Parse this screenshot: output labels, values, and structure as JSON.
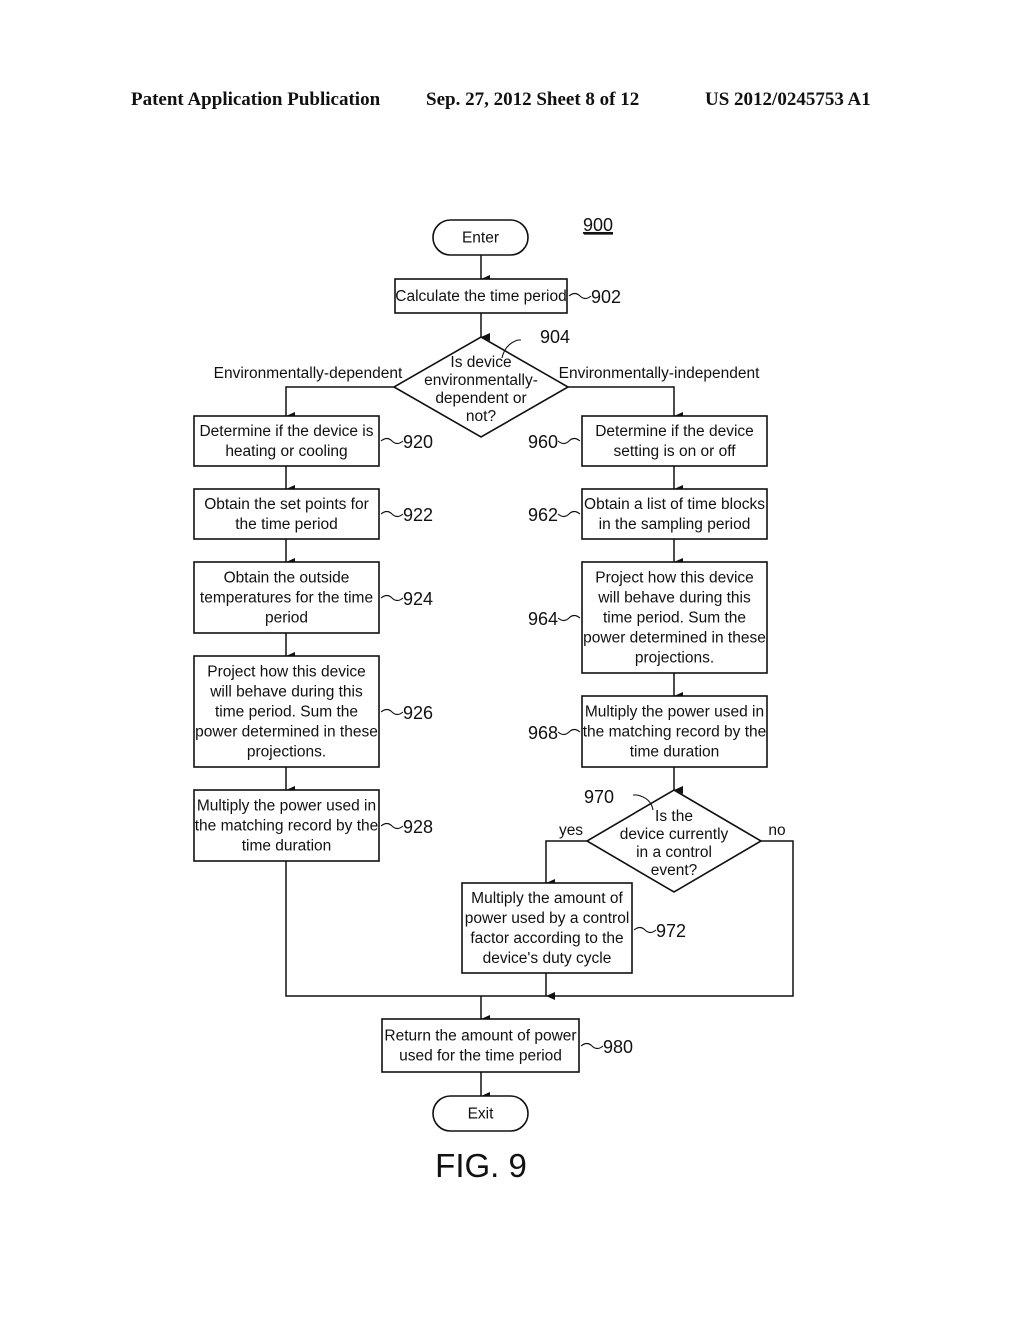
{
  "header": {
    "left": "Patent Application Publication",
    "center": "Sep. 27, 2012   Sheet 8 of 12",
    "right": "US 2012/0245753 A1"
  },
  "figure": {
    "ref": "900",
    "caption": "FIG. 9"
  },
  "nodes": {
    "enter": {
      "type": "terminal",
      "lines": [
        "Enter"
      ]
    },
    "n902": {
      "type": "process",
      "ref": "902",
      "lines": [
        "Calculate the time period"
      ]
    },
    "n904": {
      "type": "decision",
      "ref": "904",
      "lines": [
        "Is device",
        "environmentally-",
        "dependent or",
        "not?"
      ]
    },
    "n920": {
      "type": "process",
      "ref": "920",
      "lines": [
        "Determine if the device is",
        "heating or cooling"
      ]
    },
    "n922": {
      "type": "process",
      "ref": "922",
      "lines": [
        "Obtain the set points for",
        "the time period"
      ]
    },
    "n924": {
      "type": "process",
      "ref": "924",
      "lines": [
        "Obtain the outside",
        "temperatures for the time",
        "period"
      ]
    },
    "n926": {
      "type": "process",
      "ref": "926",
      "lines": [
        "Project how this device",
        "will behave during this",
        "time period. Sum the",
        "power determined in these",
        "projections."
      ]
    },
    "n928": {
      "type": "process",
      "ref": "928",
      "lines": [
        "Multiply the power used in",
        "the matching record by the",
        "time duration"
      ]
    },
    "n960": {
      "type": "process",
      "ref": "960",
      "lines": [
        "Determine if the device",
        "setting is on or off"
      ]
    },
    "n962": {
      "type": "process",
      "ref": "962",
      "lines": [
        "Obtain a list of time blocks",
        "in the sampling period"
      ]
    },
    "n964": {
      "type": "process",
      "ref": "964",
      "lines": [
        "Project how this device",
        "will behave during this",
        "time period. Sum the",
        "power determined in these",
        "projections."
      ]
    },
    "n968": {
      "type": "process",
      "ref": "968",
      "lines": [
        "Multiply the power used in",
        "the matching record by the",
        "time duration"
      ]
    },
    "n970": {
      "type": "decision",
      "ref": "970",
      "lines": [
        "Is the",
        "device currently",
        "in a control",
        "event?"
      ]
    },
    "n972": {
      "type": "process",
      "ref": "972",
      "lines": [
        "Multiply the amount of",
        "power used by a control",
        "factor according to the",
        "device's duty cycle"
      ]
    },
    "n980": {
      "type": "process",
      "ref": "980",
      "lines": [
        "Return the amount of power",
        "used for the time period"
      ]
    },
    "exit": {
      "type": "terminal",
      "lines": [
        "Exit"
      ]
    }
  },
  "edge_labels": {
    "left_branch": "Environmentally-dependent",
    "right_branch": "Environmentally-independent",
    "yes": "yes",
    "no": "no"
  },
  "edges": [
    [
      "enter",
      "n902"
    ],
    [
      "n902",
      "n904"
    ],
    [
      "n904",
      "n920",
      "Environmentally-dependent"
    ],
    [
      "n904",
      "n960",
      "Environmentally-independent"
    ],
    [
      "n920",
      "n922"
    ],
    [
      "n922",
      "n924"
    ],
    [
      "n924",
      "n926"
    ],
    [
      "n926",
      "n928"
    ],
    [
      "n928",
      "n980"
    ],
    [
      "n960",
      "n962"
    ],
    [
      "n962",
      "n964"
    ],
    [
      "n964",
      "n968"
    ],
    [
      "n968",
      "n970"
    ],
    [
      "n970",
      "n972",
      "yes"
    ],
    [
      "n970",
      "n980",
      "no"
    ],
    [
      "n972",
      "n980"
    ],
    [
      "n980",
      "exit"
    ]
  ]
}
